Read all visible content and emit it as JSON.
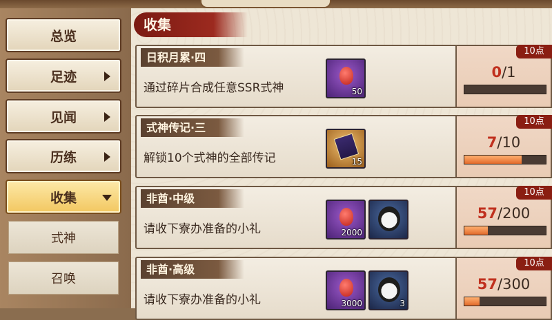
{
  "section_title": "收集",
  "sidebar": {
    "items": [
      {
        "label": "总览",
        "has_arrow": false
      },
      {
        "label": "足迹",
        "has_arrow": true
      },
      {
        "label": "见闻",
        "has_arrow": true
      },
      {
        "label": "历练",
        "has_arrow": true
      },
      {
        "label": "收集",
        "has_arrow": true,
        "active": true
      }
    ],
    "subitems": [
      {
        "label": "式神"
      },
      {
        "label": "召唤"
      }
    ]
  },
  "tasks": [
    {
      "title": "日积月累·四",
      "description": "通过碎片合成任意SSR式神",
      "rewards": [
        {
          "icon": "jade-icon",
          "qty": "50",
          "color": "purple"
        }
      ],
      "points": "10点",
      "current": "0",
      "total": "/1",
      "progress": 0.0
    },
    {
      "title": "式神传记·三",
      "description": "解锁10个式神的全部传记",
      "rewards": [
        {
          "icon": "scroll-icon",
          "qty": "15",
          "color": "gold"
        }
      ],
      "points": "10点",
      "current": "7",
      "total": "/10",
      "progress": 0.7
    },
    {
      "title": "非酋·中级",
      "description": "请收下寮办准备的小礼",
      "rewards": [
        {
          "icon": "jade-icon",
          "qty": "2000",
          "color": "purple"
        },
        {
          "icon": "daruma-icon",
          "qty": "",
          "color": "blue"
        }
      ],
      "points": "10点",
      "current": "57",
      "total": "/200",
      "progress": 0.285
    },
    {
      "title": "非酋·高级",
      "description": "请收下寮办准备的小礼",
      "rewards": [
        {
          "icon": "jade-icon",
          "qty": "3000",
          "color": "purple"
        },
        {
          "icon": "daruma-icon",
          "qty": "3",
          "color": "blue"
        }
      ],
      "points": "10点",
      "current": "57",
      "total": "/300",
      "progress": 0.19
    }
  ]
}
